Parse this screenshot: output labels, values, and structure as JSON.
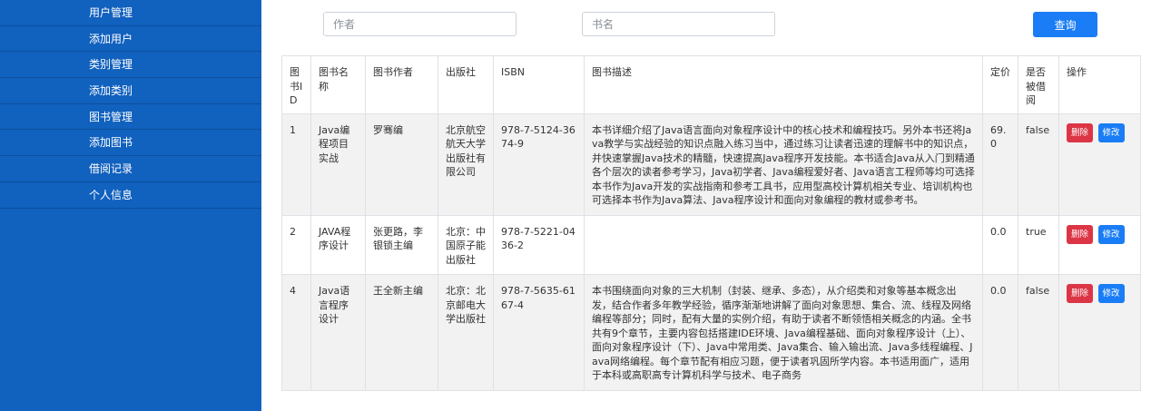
{
  "sidebar": {
    "items": [
      {
        "label": "用户管理"
      },
      {
        "label": "添加用户"
      },
      {
        "label": "类别管理"
      },
      {
        "label": "添加类别"
      },
      {
        "label": "图书管理"
      },
      {
        "label": "添加图书"
      },
      {
        "label": "借阅记录"
      },
      {
        "label": "个人信息"
      }
    ]
  },
  "search": {
    "author_placeholder": "作者",
    "title_placeholder": "书名",
    "query_label": "查询"
  },
  "table": {
    "headers": {
      "id": "图书ID",
      "name": "图书名称",
      "author": "图书作者",
      "publisher": "出版社",
      "isbn": "ISBN",
      "desc": "图书描述",
      "price": "定价",
      "borrowed": "是否被借阅",
      "ops": "操作"
    },
    "rows": [
      {
        "id": "1",
        "name": "Java编程项目实战",
        "author": "罗骞编",
        "publisher": "北京航空航天大学出版社有限公司",
        "isbn": "978-7-5124-3674-9",
        "desc": "本书详细介绍了Java语言面向对象程序设计中的核心技术和编程技巧。另外本书还将Java教学与实战经验的知识点融入练习当中，通过练习让读者迅速的理解书中的知识点，并快速掌握Java技术的精髓，快速提高Java程序开发技能。本书适合Java从入门到精通各个层次的读者参考学习，Java初学者、Java编程爱好者、Java语言工程师等均可选择本书作为Java开发的实战指南和参考工具书，应用型高校计算机相关专业、培训机构也可选择本书作为Java算法、Java程序设计和面向对象编程的教材或参考书。",
        "price": "69.0",
        "borrowed": "false",
        "delete_label": "删除",
        "edit_label": "修改"
      },
      {
        "id": "2",
        "name": "JAVA程序设计",
        "author": "张更路，李银锁主编",
        "publisher": "北京：中国原子能出版社",
        "isbn": "978-7-5221-0436-2",
        "desc": "",
        "price": "0.0",
        "borrowed": "true",
        "delete_label": "删除",
        "edit_label": "修改"
      },
      {
        "id": "4",
        "name": "Java语言程序设计",
        "author": "王全新主编",
        "publisher": "北京：北京邮电大学出版社",
        "isbn": "978-7-5635-6167-4",
        "desc": "本书围绕面向对象的三大机制（封装、继承、多态），从介绍类和对象等基本概念出发，结合作者多年教学经验，循序渐渐地讲解了面向对象思想、集合、流、线程及网络编程等部分；同时，配有大量的实例介绍，有助于读者不断领悟相关概念的内涵。全书共有9个章节，主要内容包括搭建IDE环境、Java编程基础、面向对象程序设计（上）、面向对象程序设计（下）、Java中常用类、Java集合、输入输出流、Java多线程编程、Java网络编程。每个章节配有相应习题，便于读者巩固所学内容。本书适用面广，适用于本科或高职高专计算机科学与技术、电子商务",
        "price": "0.0",
        "borrowed": "false",
        "delete_label": "删除",
        "edit_label": "修改"
      }
    ]
  },
  "colors": {
    "sidebar_bg": "#1161be",
    "primary": "#1a7df5",
    "danger": "#dc3545"
  }
}
